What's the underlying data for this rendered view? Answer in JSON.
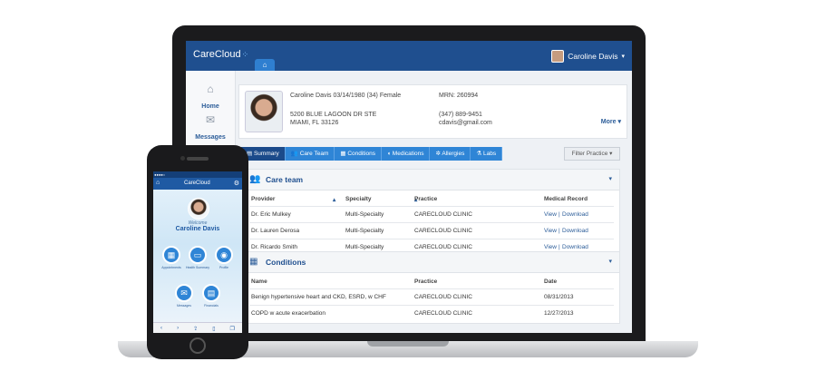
{
  "app": {
    "logo": "CareCloud",
    "home_tab_icon": "home-icon",
    "user_name": "Caroline Davis"
  },
  "leftnav": {
    "items": [
      {
        "label": "Home",
        "icon": "home-icon"
      },
      {
        "label": "Messages",
        "icon": "chat-icon"
      }
    ]
  },
  "patient": {
    "name_line": "Caroline Davis  03/14/1980  (34) Female",
    "mrn": "MRN: 260994",
    "address1": "5200 BLUE LAGOON DR STE",
    "address2": "MIAMI, FL 33126",
    "phone": "(347) 889-9451",
    "email": "cdavis@gmail.com",
    "more": "More"
  },
  "tabs": [
    {
      "label": "Summary",
      "icon": "list-icon",
      "active": true
    },
    {
      "label": "Care Team",
      "icon": "people-icon"
    },
    {
      "label": "Conditions",
      "icon": "clipboard-icon"
    },
    {
      "label": "Medications",
      "icon": "pill-icon"
    },
    {
      "label": "Allergies",
      "icon": "allergy-icon"
    },
    {
      "label": "Labs",
      "icon": "flask-icon"
    }
  ],
  "filter": {
    "label": "Filter Practice"
  },
  "care_team": {
    "title": "Care team",
    "columns": [
      "Provider",
      "Specialty",
      "Practice",
      "Medical Record"
    ],
    "rows": [
      {
        "provider": "Dr. Eric Mulkey",
        "specialty": "Multi-Specialty",
        "practice": "CARECLOUD CLINIC",
        "view": "View",
        "download": "Download"
      },
      {
        "provider": "Dr. Lauren Derosa",
        "specialty": "Multi-Specialty",
        "practice": "CARECLOUD CLINIC",
        "view": "View",
        "download": "Download"
      },
      {
        "provider": "Dr. Ricardo Smith",
        "specialty": "Multi-Specialty",
        "practice": "CARECLOUD CLINIC",
        "view": "View",
        "download": "Download"
      }
    ]
  },
  "conditions": {
    "title": "Conditions",
    "columns": [
      "Name",
      "Practice",
      "Date"
    ],
    "rows": [
      {
        "name": "Benign hypertensive heart and CKD, ESRD, w CHF",
        "practice": "CARECLOUD CLINIC",
        "date": "08/31/2013"
      },
      {
        "name": "COPD w acute exacerbation",
        "practice": "CARECLOUD CLINIC",
        "date": "12/27/2013"
      }
    ]
  },
  "phone": {
    "logo": "CareCloud",
    "welcome": "Welcome",
    "user_name": "Caroline Davis",
    "buttons": [
      {
        "label": "Appointments",
        "icon": "calendar-icon"
      },
      {
        "label": "Health Summary",
        "icon": "folder-icon"
      },
      {
        "label": "Profile",
        "icon": "user-icon"
      },
      {
        "label": "Messages",
        "icon": "mail-icon"
      },
      {
        "label": "Financials",
        "icon": "document-icon"
      }
    ]
  },
  "colors": {
    "topbar": "#1f4f8f",
    "tab": "#2f85d6",
    "tab_active": "#1b4a8a",
    "link": "#2c5d99"
  }
}
